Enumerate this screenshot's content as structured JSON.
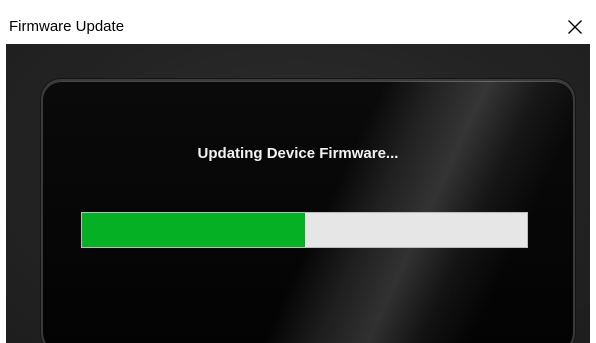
{
  "window": {
    "title": "Firmware Update",
    "close_icon": "close-icon"
  },
  "content": {
    "status_text": "Updating Device Firmware...",
    "progress": {
      "percent": 50,
      "fill_color": "#06b025",
      "track_color": "#e6e6e6"
    }
  },
  "colors": {
    "background": "#242424",
    "panel": "#050505"
  }
}
